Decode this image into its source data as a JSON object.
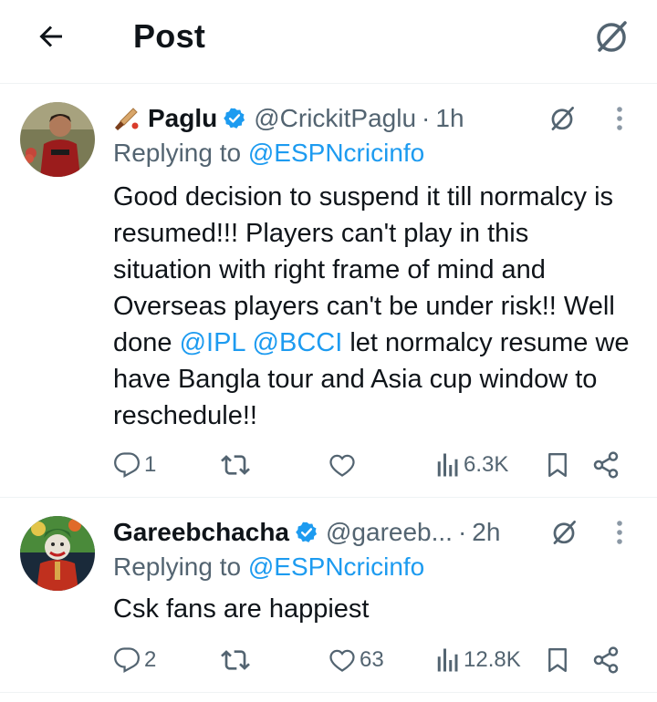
{
  "header": {
    "title": "Post",
    "back_icon": "arrow-left-icon",
    "grok_icon": "grok-icon"
  },
  "posts": [
    {
      "display_name": "Paglu",
      "name_emoji": "cricket-bat-icon",
      "handle": "@CrickitPaglu",
      "separator": "·",
      "time": "1h",
      "replying_prefix": "Replying to ",
      "replying_to": "@ESPNcricinfo",
      "text_parts": [
        "Good decision to suspend it till normalcy is resumed!!! Players can't play in this situation with right frame of mind and Overseas players can't be under risk!! Well done ",
        "@IPL",
        " ",
        "@BCCI",
        " let normalcy resume we have Bangla tour and Asia cup window to reschedule!!"
      ],
      "replies": "1",
      "reposts": "",
      "likes": "",
      "views": "6.3K"
    },
    {
      "display_name": "Gareebchacha",
      "handle": "@gareeb...",
      "separator": "·",
      "time": "2h",
      "replying_prefix": "Replying to ",
      "replying_to": "@ESPNcricinfo",
      "text": "Csk fans are happiest",
      "replies": "2",
      "reposts": "",
      "likes": "63",
      "views": "12.8K"
    }
  ],
  "colors": {
    "accent": "#1d9bf0",
    "muted": "#536471",
    "text": "#0f1419",
    "divider": "#eff3f4"
  }
}
